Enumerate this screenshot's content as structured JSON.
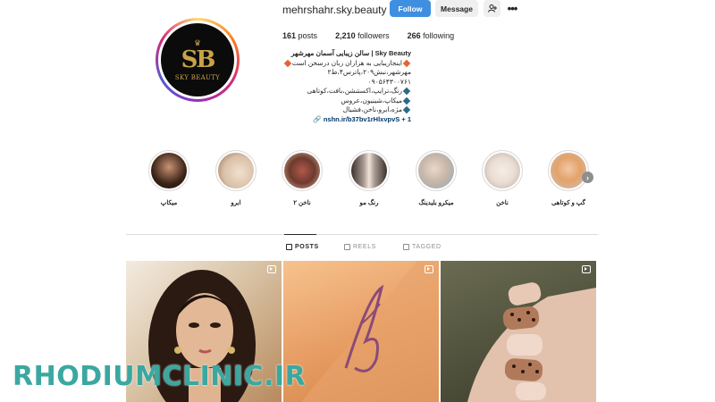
{
  "profile": {
    "username": "mehrshahr.sky.beauty",
    "avatar_brand": "SKY BEAUTY",
    "avatar_monogram": "SB",
    "follow_label": "Follow",
    "message_label": "Message",
    "add_user_icon": "add-user-icon",
    "more_icon": "more-icon",
    "posts": "161",
    "posts_label": "posts",
    "followers": "2,210",
    "followers_label": "followers",
    "following": "266",
    "following_label": "following",
    "bio": [
      "Sky Beauty | سالن زیبایی آسمان مهرشهر",
      "اینجازیبایی به هزاران زبان درسخن است",
      "مهرشهر،نبش۲۰۹،پاترس۴،ط۲",
      "۰۹۰۵۶۴۳۰۰۷۶۱",
      "رنگ،ترایپ،اکستنشن،بافت،کوتاهی",
      "میکاپ،شینیون،عروس",
      "مژه،ابرو،ناخن،فشیال"
    ],
    "link": "nshn.ir/b37bv1rHlxvpvS + 1"
  },
  "highlights": [
    {
      "label": "میکاپ",
      "color": "#3b2418"
    },
    {
      "label": "ابرو",
      "color": "#d9c0a8"
    },
    {
      "label": "ناخن ۲",
      "color": "#b0584a"
    },
    {
      "label": "رنگ مو",
      "color": "#7a6e68"
    },
    {
      "label": "میکرو بلیدینگ",
      "color": "#c9b8a9"
    },
    {
      "label": "ناخن",
      "color": "#e9ddd3"
    },
    {
      "label": "گپ و کوتاهی",
      "color": "#e4a26a"
    }
  ],
  "tabs": [
    {
      "label": "POSTS",
      "icon": "grid-icon"
    },
    {
      "label": "REELS",
      "icon": "reels-icon"
    },
    {
      "label": "TAGGED",
      "icon": "tagged-icon"
    }
  ],
  "posts_grid": [
    {
      "type": "reel",
      "subject": "makeup-portrait"
    },
    {
      "type": "reel",
      "subject": "henna-tattoo-arm"
    },
    {
      "type": "reel",
      "subject": "leopard-nails"
    }
  ],
  "watermark": "RHODIUMCLINIC.IR"
}
